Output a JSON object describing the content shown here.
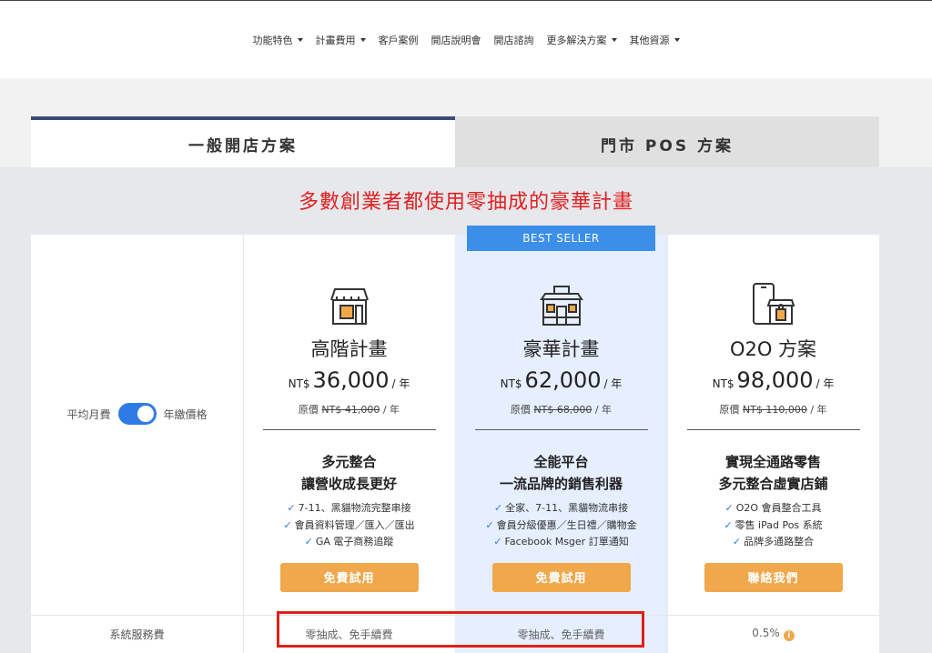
{
  "nav": {
    "items": [
      {
        "label": "功能特色",
        "dropdown": true
      },
      {
        "label": "計畫費用",
        "dropdown": true
      },
      {
        "label": "客戶案例",
        "dropdown": false
      },
      {
        "label": "開店說明會",
        "dropdown": false
      },
      {
        "label": "開店諮詢",
        "dropdown": false
      },
      {
        "label": "更多解決方案",
        "dropdown": true
      },
      {
        "label": "其他資源",
        "dropdown": true
      }
    ]
  },
  "tabs": {
    "online": "一般開店方案",
    "pos": "門市 POS 方案"
  },
  "headline": "多數創業者都使用零抽成的豪華計畫",
  "billing": {
    "monthly": "平均月費",
    "yearly": "年繳價格",
    "toggle_state": "yearly"
  },
  "best_seller": "BEST SELLER",
  "plans": [
    {
      "name": "高階計畫",
      "currency": "NT$",
      "price": "36,000",
      "per": "/ 年",
      "orig_label": "原價",
      "orig_price": "NT$ 41,000",
      "orig_per": "/ 年",
      "tag1": "多元整合",
      "tag2": "讓營收成長更好",
      "features": [
        "7-11、黑貓物流完整串接",
        "會員資料管理／匯入／匯出",
        "GA 電子商務追蹤"
      ],
      "button": "免費試用",
      "icon": "storefront-icon"
    },
    {
      "name": "豪華計畫",
      "currency": "NT$",
      "price": "62,000",
      "per": "/ 年",
      "orig_label": "原價",
      "orig_price": "NT$ 68,000",
      "orig_per": "/ 年",
      "tag1": "全能平台",
      "tag2": "一流品牌的銷售利器",
      "features": [
        "全家、7-11、黑貓物流串接",
        "會員分級優惠／生日禮／購物金",
        "Facebook Msger 訂單通知"
      ],
      "button": "免費試用",
      "icon": "store-building-icon"
    },
    {
      "name": "O2O 方案",
      "currency": "NT$",
      "price": "98,000",
      "per": "/ 年",
      "orig_label": "原價",
      "orig_price": "NT$ 110,000",
      "orig_per": "/ 年",
      "tag1": "實現全通路零售",
      "tag2": "多元整合虛實店鋪",
      "features": [
        "O2O 會員整合工具",
        "零售 iPad Pos 系統",
        "品牌多通路整合"
      ],
      "button": "聯絡我們",
      "icon": "phone-store-icon"
    }
  ],
  "fee_row": {
    "label": "系統服務費",
    "values": [
      "零抽成、免手續費",
      "零抽成、免手續費",
      "0.5%"
    ]
  },
  "colors": {
    "accent_blue": "#2f7be6",
    "orange": "#f0a84b",
    "headline_red": "#e02020",
    "tab_active_border": "#3c4a7a",
    "highlight_bg": "#e6efff"
  }
}
